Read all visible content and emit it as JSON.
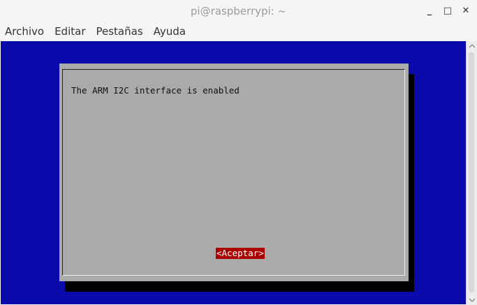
{
  "window": {
    "title": "pi@raspberrypi: ~",
    "controls": {
      "minimize": "_",
      "maximize": "□",
      "close": "✕"
    }
  },
  "menu": {
    "items": [
      {
        "label": "Archivo"
      },
      {
        "label": "Editar"
      },
      {
        "label": "Pestañas"
      },
      {
        "label": "Ayuda"
      }
    ]
  },
  "dialog": {
    "message": "The ARM I2C interface is enabled",
    "ok_label": "<Aceptar>"
  },
  "colors": {
    "terminal_background": "#0a0aaa",
    "dialog_background": "#aaaaaa",
    "button_background": "#aa0000"
  }
}
